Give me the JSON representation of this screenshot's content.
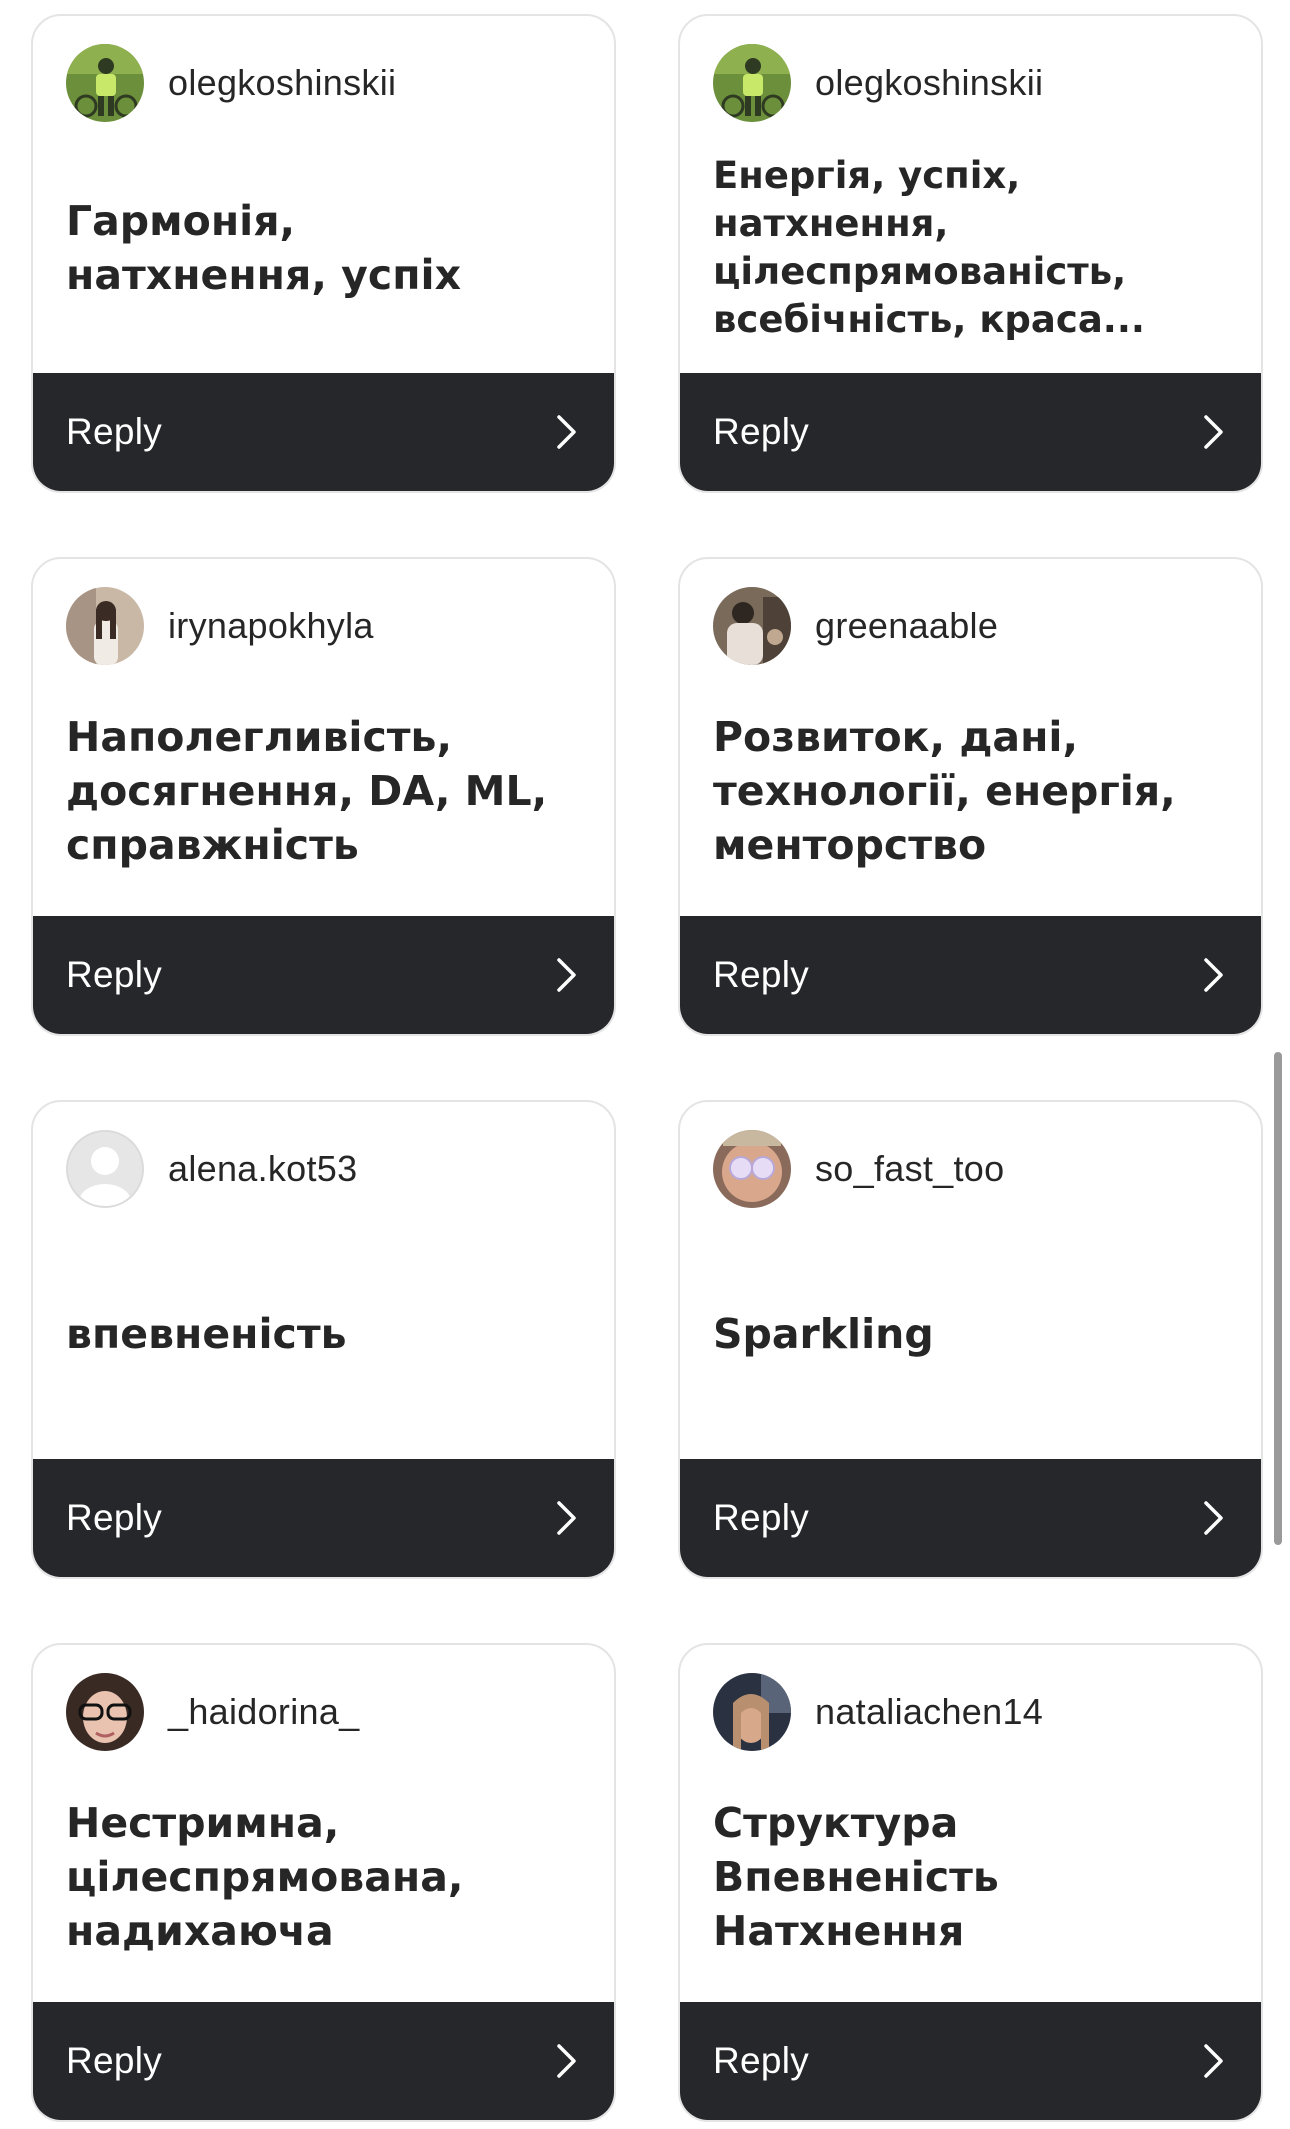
{
  "reply_label": "Reply",
  "cards": [
    {
      "username": "olegkoshinskii",
      "message": "Гармонія,\nнатхнення, успіх",
      "avatar": "olegkoshinskii-avatar",
      "avatar_colors": [
        "#6b8f3a",
        "#c8e86a",
        "#2f3a22"
      ]
    },
    {
      "username": "olegkoshinskii",
      "message": "Енергія, успіх,\nнатхнення,\nцілеспрямованість,\nвсебічність, краса...",
      "avatar": "olegkoshinskii-avatar",
      "avatar_colors": [
        "#6b8f3a",
        "#c8e86a",
        "#2f3a22"
      ]
    },
    {
      "username": "irynapokhyla",
      "message": "Наполегливість,\nдосягнення, DA, ML,\nсправжність",
      "avatar": "irynapokhyla-avatar",
      "avatar_colors": [
        "#c9b8a6",
        "#f0ebe4",
        "#3a2c24"
      ]
    },
    {
      "username": "greenaable",
      "message": "Розвиток, дані,\nтехнології, енергія,\nменторство",
      "avatar": "greenaable-avatar",
      "avatar_colors": [
        "#7a6a5a",
        "#e8e0d8",
        "#2e2620"
      ]
    },
    {
      "username": "alena.kot53",
      "message": "впевненість",
      "avatar": "default-avatar",
      "avatar_colors": [
        "#dbdbdb",
        "#ffffff",
        "#dbdbdb"
      ]
    },
    {
      "username": "so_fast_too",
      "message": "Sparkling",
      "avatar": "so_fast_too-avatar",
      "avatar_colors": [
        "#d9a88c",
        "#e6dcf5",
        "#8a6a5a"
      ]
    },
    {
      "username": "_haidorina_",
      "message": "Нестримна,\nцілеспрямована,\nнадихаюча",
      "avatar": "_haidorina_-avatar",
      "avatar_colors": [
        "#3a2a24",
        "#e9c2b0",
        "#111111"
      ]
    },
    {
      "username": "nataliachen14",
      "message": "Структура\nВпевненість\nНатхнення",
      "avatar": "nataliachen14-avatar",
      "avatar_colors": [
        "#2a3140",
        "#d8a88a",
        "#b89070"
      ]
    }
  ]
}
